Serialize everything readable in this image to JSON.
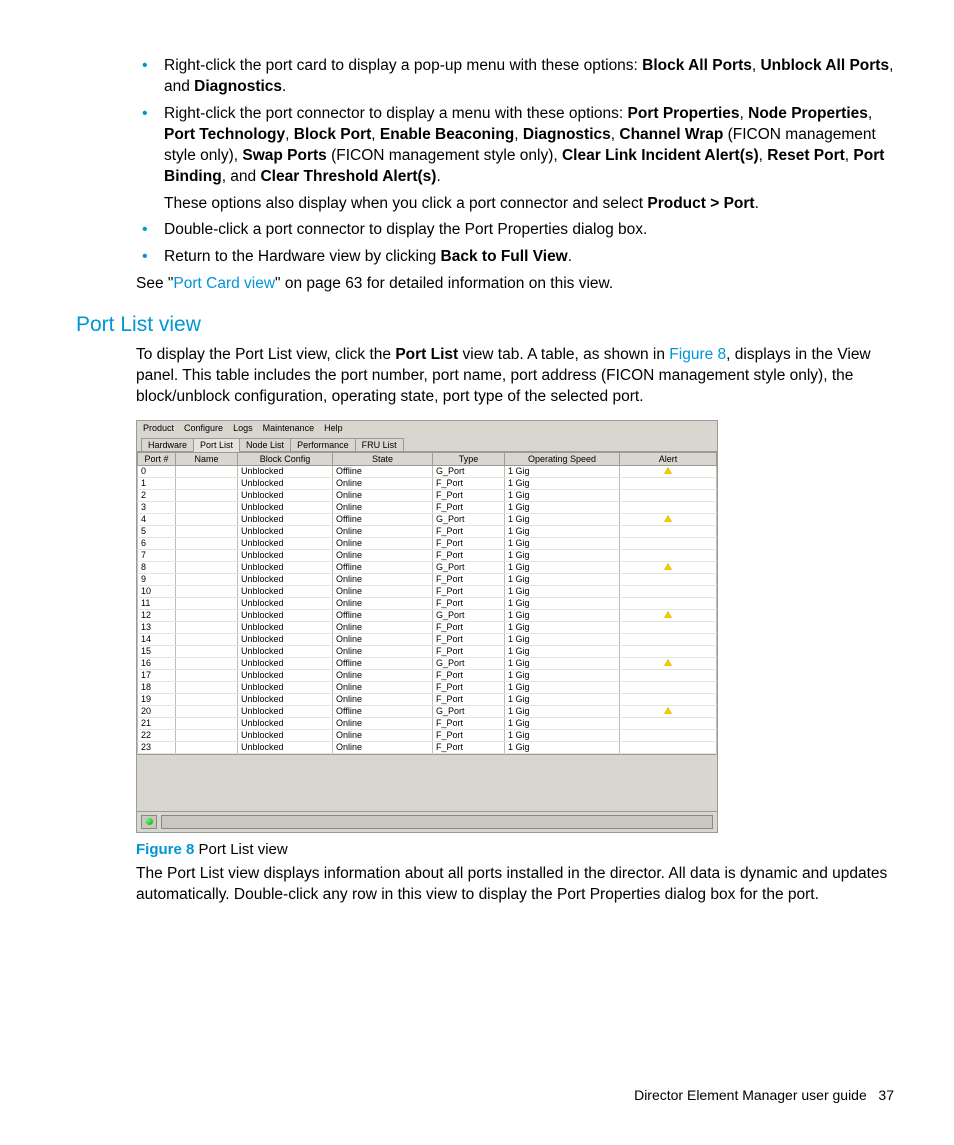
{
  "bullets": {
    "b1_pre": "Right-click the port card to display a pop-up menu with these options: ",
    "b1_bold1": "Block All Ports",
    "b1_mid1": ", ",
    "b1_bold2": "Unblock All Ports",
    "b1_mid2": ", and ",
    "b1_bold3": "Diagnostics",
    "b1_end": ".",
    "b2_pre": "Right-click the port connector to display a menu with these options: ",
    "b2_bold1": "Port Properties",
    "b2_c1": ", ",
    "b2_bold2": "Node Properties",
    "b2_c2": ", ",
    "b2_bold3": "Port Technology",
    "b2_c3": ", ",
    "b2_bold4": "Block Port",
    "b2_c4": ", ",
    "b2_bold5": "Enable Beaconing",
    "b2_c5": ", ",
    "b2_bold6": "Diagnostics",
    "b2_c6": ", ",
    "b2_bold7": "Channel Wrap",
    "b2_c7": " (FICON management style only), ",
    "b2_bold8": "Swap Ports",
    "b2_c8": " (FICON management style only), ",
    "b2_bold9": "Clear Link Incident Alert(s)",
    "b2_c9": ", ",
    "b2_bold10": "Reset Port",
    "b2_c10": ", ",
    "b2_bold11": "Port Binding",
    "b2_c11": ", and ",
    "b2_bold12": "Clear Threshold Alert(s)",
    "b2_end": ".",
    "b2_sub_pre": "These options also display when you click a port connector and select ",
    "b2_sub_bold": "Product > Port",
    "b2_sub_end": ".",
    "b3": "Double-click a port connector to display the Port Properties dialog box.",
    "b4_pre": "Return to the Hardware view by clicking ",
    "b4_bold": "Back to Full View",
    "b4_end": "."
  },
  "see_line": {
    "pre": "See \"",
    "link": "Port Card view",
    "post": "\" on page 63 for detailed information on this view."
  },
  "heading": "Port List view",
  "intro": {
    "pre": "To display the Port List view, click the ",
    "bold": "Port List",
    "mid": " view tab. A table, as shown in ",
    "link": "Figure 8",
    "post": ", displays in the View panel. This table includes the port number, port name, port address (FICON management style only), the block/unblock configuration, operating state, port type of the selected port."
  },
  "app": {
    "menu": [
      "Product",
      "Configure",
      "Logs",
      "Maintenance",
      "Help"
    ],
    "tabs": [
      "Hardware",
      "Port List",
      "Node List",
      "Performance",
      "FRU List"
    ],
    "active_tab": 1,
    "columns": [
      "Port #",
      "Name",
      "Block Config",
      "State",
      "Type",
      "Operating Speed",
      "Alert"
    ],
    "rows": [
      {
        "port": "0",
        "name": "",
        "block": "Unblocked",
        "state": "Offline",
        "type": "G_Port",
        "speed": "1 Gig",
        "alert": true
      },
      {
        "port": "1",
        "name": "",
        "block": "Unblocked",
        "state": "Online",
        "type": "F_Port",
        "speed": "1 Gig",
        "alert": false
      },
      {
        "port": "2",
        "name": "",
        "block": "Unblocked",
        "state": "Online",
        "type": "F_Port",
        "speed": "1 Gig",
        "alert": false
      },
      {
        "port": "3",
        "name": "",
        "block": "Unblocked",
        "state": "Online",
        "type": "F_Port",
        "speed": "1 Gig",
        "alert": false
      },
      {
        "port": "4",
        "name": "",
        "block": "Unblocked",
        "state": "Offline",
        "type": "G_Port",
        "speed": "1 Gig",
        "alert": true
      },
      {
        "port": "5",
        "name": "",
        "block": "Unblocked",
        "state": "Online",
        "type": "F_Port",
        "speed": "1 Gig",
        "alert": false
      },
      {
        "port": "6",
        "name": "",
        "block": "Unblocked",
        "state": "Online",
        "type": "F_Port",
        "speed": "1 Gig",
        "alert": false
      },
      {
        "port": "7",
        "name": "",
        "block": "Unblocked",
        "state": "Online",
        "type": "F_Port",
        "speed": "1 Gig",
        "alert": false
      },
      {
        "port": "8",
        "name": "",
        "block": "Unblocked",
        "state": "Offline",
        "type": "G_Port",
        "speed": "1 Gig",
        "alert": true
      },
      {
        "port": "9",
        "name": "",
        "block": "Unblocked",
        "state": "Online",
        "type": "F_Port",
        "speed": "1 Gig",
        "alert": false
      },
      {
        "port": "10",
        "name": "",
        "block": "Unblocked",
        "state": "Online",
        "type": "F_Port",
        "speed": "1 Gig",
        "alert": false
      },
      {
        "port": "11",
        "name": "",
        "block": "Unblocked",
        "state": "Online",
        "type": "F_Port",
        "speed": "1 Gig",
        "alert": false
      },
      {
        "port": "12",
        "name": "",
        "block": "Unblocked",
        "state": "Offline",
        "type": "G_Port",
        "speed": "1 Gig",
        "alert": true
      },
      {
        "port": "13",
        "name": "",
        "block": "Unblocked",
        "state": "Online",
        "type": "F_Port",
        "speed": "1 Gig",
        "alert": false
      },
      {
        "port": "14",
        "name": "",
        "block": "Unblocked",
        "state": "Online",
        "type": "F_Port",
        "speed": "1 Gig",
        "alert": false
      },
      {
        "port": "15",
        "name": "",
        "block": "Unblocked",
        "state": "Online",
        "type": "F_Port",
        "speed": "1 Gig",
        "alert": false
      },
      {
        "port": "16",
        "name": "",
        "block": "Unblocked",
        "state": "Offline",
        "type": "G_Port",
        "speed": "1 Gig",
        "alert": true
      },
      {
        "port": "17",
        "name": "",
        "block": "Unblocked",
        "state": "Online",
        "type": "F_Port",
        "speed": "1 Gig",
        "alert": false
      },
      {
        "port": "18",
        "name": "",
        "block": "Unblocked",
        "state": "Online",
        "type": "F_Port",
        "speed": "1 Gig",
        "alert": false
      },
      {
        "port": "19",
        "name": "",
        "block": "Unblocked",
        "state": "Online",
        "type": "F_Port",
        "speed": "1 Gig",
        "alert": false
      },
      {
        "port": "20",
        "name": "",
        "block": "Unblocked",
        "state": "Offline",
        "type": "G_Port",
        "speed": "1 Gig",
        "alert": true
      },
      {
        "port": "21",
        "name": "",
        "block": "Unblocked",
        "state": "Online",
        "type": "F_Port",
        "speed": "1 Gig",
        "alert": false
      },
      {
        "port": "22",
        "name": "",
        "block": "Unblocked",
        "state": "Online",
        "type": "F_Port",
        "speed": "1 Gig",
        "alert": false
      },
      {
        "port": "23",
        "name": "",
        "block": "Unblocked",
        "state": "Online",
        "type": "F_Port",
        "speed": "1 Gig",
        "alert": false
      }
    ]
  },
  "fig_caption": {
    "num": "Figure 8",
    "text": " Port List view"
  },
  "after_fig": "The Port List view displays information about all ports installed in the director. All data is dynamic and updates automatically. Double-click any row in this view to display the Port Properties dialog box for the port.",
  "footer": {
    "title": "Director Element Manager user guide",
    "page": "37"
  }
}
